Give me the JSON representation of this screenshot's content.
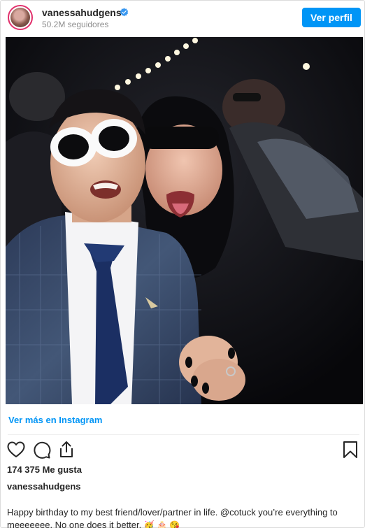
{
  "profile": {
    "username": "vanessahudgens",
    "followers": "50.2M seguidores",
    "view_profile_label": "Ver perfil"
  },
  "post": {
    "view_more_label": "Ver más en Instagram",
    "likes": "174 375 Me gusta",
    "caption_user": "vanessahudgens",
    "caption_text": "Happy birthday to my best friend/lover/partner in life. @cotuck you’re everything to meeeeeee. No one does it better.",
    "caption_emojis": "🥳 🎂 😘"
  },
  "colors": {
    "brand_blue": "#0095f6",
    "text": "#262626",
    "muted": "#8e8e8e"
  },
  "icons": {
    "verified": "verified-badge-icon",
    "like": "heart-icon",
    "comment": "comment-icon",
    "share": "share-icon",
    "save": "bookmark-icon"
  }
}
